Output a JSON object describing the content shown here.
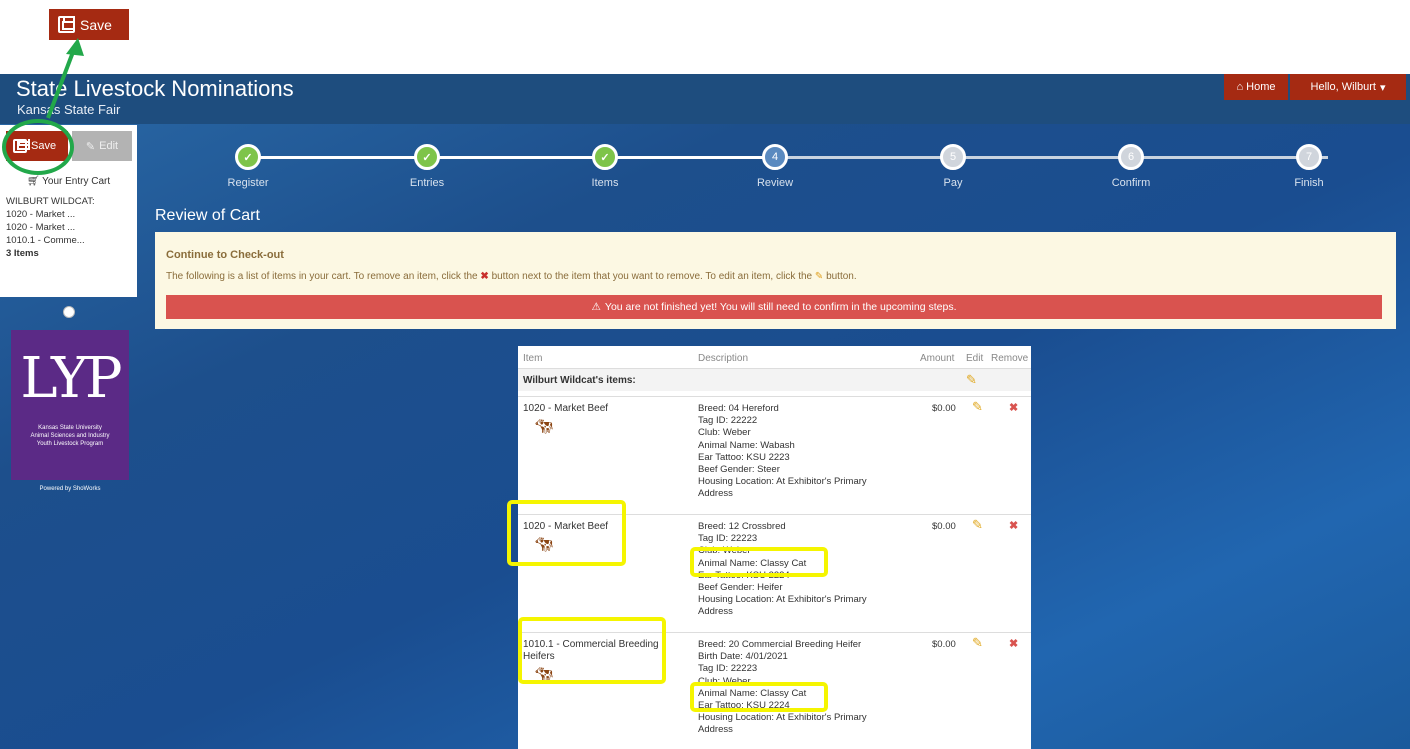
{
  "annotation": {
    "save_label": "Save"
  },
  "header": {
    "title": "State Livestock Nominations",
    "subtitle": "Kansas State Fair",
    "home_label": "Home",
    "user_label": "Hello, Wilburt"
  },
  "sidebar": {
    "save_label": "Save",
    "edit_label": "Edit",
    "cart_label": "Your Entry Cart",
    "owner": "WILBURT WILDCAT:",
    "items": [
      "1020 - Market ...",
      "1020 - Market ...",
      "1010.1 - Comme..."
    ],
    "count": "3 Items"
  },
  "logo": {
    "mark": "LYP",
    "lines": [
      "Kansas State University",
      "Animal Sciences and Industry",
      "Youth Livestock Program"
    ],
    "powered": "Powered by ShoWorks"
  },
  "steps": [
    {
      "label": "Register",
      "marker": "✓",
      "state": "done"
    },
    {
      "label": "Entries",
      "marker": "✓",
      "state": "done"
    },
    {
      "label": "Items",
      "marker": "✓",
      "state": "done"
    },
    {
      "label": "Review",
      "marker": "4",
      "state": "current"
    },
    {
      "label": "Pay",
      "marker": "5",
      "state": "todo"
    },
    {
      "label": "Confirm",
      "marker": "6",
      "state": "todo"
    },
    {
      "label": "Finish",
      "marker": "7",
      "state": "todo"
    }
  ],
  "review": {
    "title": "Review of Cart",
    "alert_heading": "Continue to Check-out",
    "alert_text_1": "The following is a list of items in your cart. To remove an item, click the",
    "alert_text_2": "button next to the item that you want to remove. To edit an item, click the",
    "alert_text_3": "button.",
    "warning": "You are not finished yet! You will still need to confirm in the upcoming steps."
  },
  "table": {
    "headers": {
      "item": "Item",
      "description": "Description",
      "amount": "Amount",
      "edit": "Edit",
      "remove": "Remove"
    },
    "group_heading": "Wilburt Wildcat's items:",
    "rows": [
      {
        "item": "1020 - Market Beef",
        "desc": [
          "Breed: 04 Hereford",
          "Tag ID: 22222",
          "Club: Weber",
          "Animal Name: Wabash",
          "Ear Tattoo: KSU 2223",
          "Beef Gender: Steer",
          "Housing Location: At Exhibitor's Primary",
          "Address"
        ],
        "amount": "$0.00"
      },
      {
        "item": "1020 - Market Beef",
        "desc": [
          "Breed: 12 Crossbred",
          "Tag ID: 22223",
          "Club: Weber",
          "Animal Name: Classy Cat",
          "Ear Tattoo: KSU 2224",
          "Beef Gender: Heifer",
          "Housing Location: At Exhibitor's Primary",
          "Address"
        ],
        "amount": "$0.00"
      },
      {
        "item": "1010.1 - Commercial Breeding Heifers",
        "desc": [
          "Breed: 20 Commercial Breeding Heifer",
          "Birth Date: 4/01/2021",
          "Tag ID: 22223",
          "Club: Weber",
          "Animal Name: Classy Cat",
          "Ear Tattoo: KSU 2224",
          "Housing Location: At Exhibitor's Primary",
          "Address"
        ],
        "amount": "$0.00"
      }
    ]
  },
  "colors": {
    "brand_red": "#a52a12",
    "header_blue": "#1e4d7e",
    "highlight_yellow": "#f5f500",
    "highlight_green": "#22a84a",
    "warning_red": "#d9534f"
  }
}
